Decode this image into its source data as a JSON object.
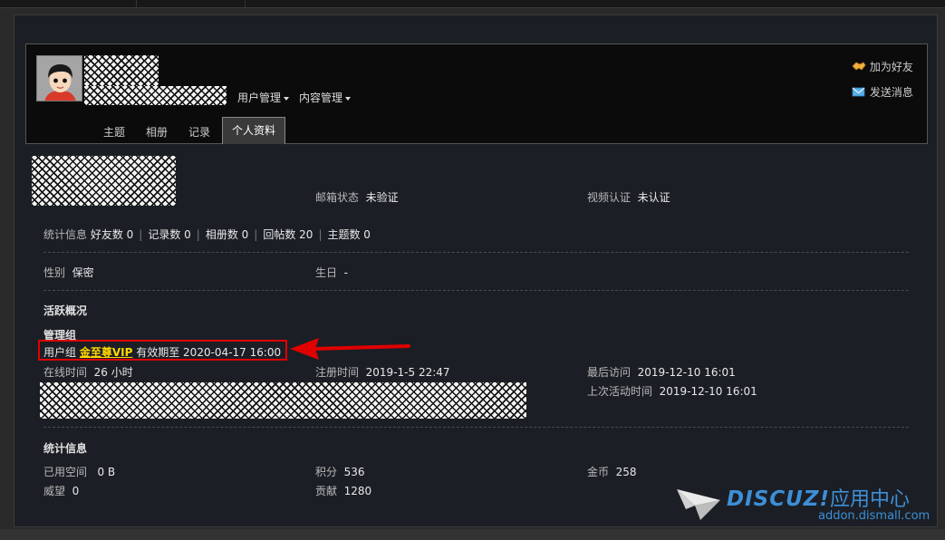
{
  "header": {
    "menus": [
      {
        "label": "用户管理"
      },
      {
        "label": "内容管理"
      }
    ],
    "tabs": [
      {
        "label": "主题"
      },
      {
        "label": "相册"
      },
      {
        "label": "记录"
      },
      {
        "label": "个人资料",
        "active": true
      }
    ],
    "actions": {
      "add_friend": "加为好友",
      "send_message": "发送消息"
    }
  },
  "profile": {
    "email_status_label": "邮箱状态",
    "email_status_value": "未验证",
    "video_auth_label": "视频认证",
    "video_auth_value": "未认证",
    "stats_line": {
      "label": "统计信息",
      "items": [
        "好友数 0",
        "记录数 0",
        "相册数 0",
        "回帖数 20",
        "主题数 0"
      ]
    },
    "gender_label": "性别",
    "gender_value": "保密",
    "birthday_label": "生日",
    "birthday_value": "-"
  },
  "activity": {
    "title": "活跃概况",
    "admin_group_label": "管理组",
    "user_group_label": "用户组",
    "user_group_value": "金至尊VIP",
    "valid_until": "有效期至 2020-04-17 16:00",
    "online_time_label": "在线时间",
    "online_time_value": "26 小时",
    "register_time_label": "注册时间",
    "register_time_value": "2019-1-5 22:47",
    "last_visit_label": "最后访问",
    "last_visit_value": "2019-12-10 16:01",
    "last_active_label": "上次活动时间",
    "last_active_value": "2019-12-10 16:01"
  },
  "statistics": {
    "title": "统计信息",
    "space_label": "已用空间",
    "space_value": "0 B",
    "points_label": "积分",
    "points_value": "536",
    "gold_label": "金币",
    "gold_value": "258",
    "prestige_label": "威望",
    "prestige_value": "0",
    "contribution_label": "贡献",
    "contribution_value": "1280"
  },
  "watermark": {
    "brand": "DISCUZ!",
    "cn": "应用中心",
    "url": "addon.dismall.com"
  },
  "colors": {
    "highlight_box": "#e00000",
    "vip": "#ffd800",
    "brand": "#3d8fd6"
  }
}
